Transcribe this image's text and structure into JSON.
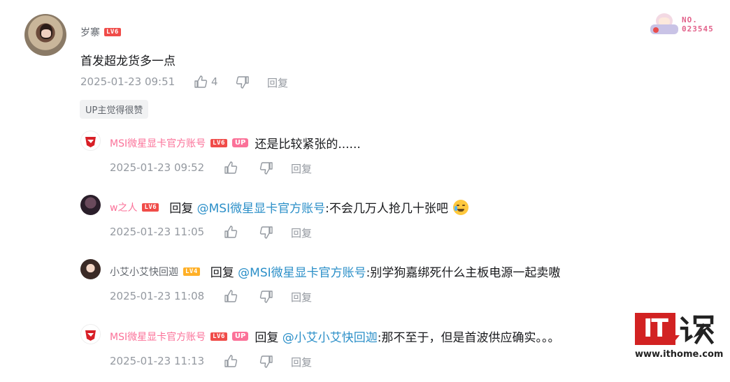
{
  "main_comment": {
    "username": "岁寨",
    "level": "LV6",
    "text": "首发超龙货多一点",
    "time": "2025-01-23 09:51",
    "likes": "4",
    "reply_label": "回复",
    "up_liked": "UP主觉得很赞",
    "fan_badge_no": "NO.",
    "fan_badge_num": "023545"
  },
  "replies": [
    {
      "username": "MSI微星显卡官方账号",
      "level": "LV6",
      "up": "UP",
      "prefix": "",
      "mention": "",
      "text": "还是比较紧张的......",
      "time": "2025-01-23 09:52",
      "reply_label": "回复"
    },
    {
      "username": "w之人",
      "level": "LV6",
      "up": "",
      "prefix": "回复 ",
      "mention": "@MSI微星显卡官方账号",
      "text": ":不会几万人抢几十张吧",
      "time": "2025-01-23 11:05",
      "reply_label": "回复"
    },
    {
      "username": "小艾小艾快回迦",
      "level": "LV4",
      "up": "",
      "prefix": "回复 ",
      "mention": "@MSI微星显卡官方账号",
      "text": ":别学狗嘉绑死什么主板电源一起卖嗷",
      "time": "2025-01-23 11:08",
      "reply_label": "回复"
    },
    {
      "username": "MSI微星显卡官方账号",
      "level": "LV6",
      "up": "UP",
      "prefix": "回复 ",
      "mention": "@小艾小艾快回迦",
      "text": ":那不至于，但是首波供应确实。。。",
      "time": "2025-01-23 11:13",
      "reply_label": "回复"
    }
  ],
  "watermark": {
    "logo": "IT",
    "site": "www.ithome.com"
  },
  "colors": {
    "accent_pink": "#fb7299",
    "mention_blue": "#2b8fc8",
    "level_red": "#f04c49",
    "level_orange": "#ffb027",
    "meta_gray": "#9499a0",
    "watermark_red": "#d22222"
  }
}
